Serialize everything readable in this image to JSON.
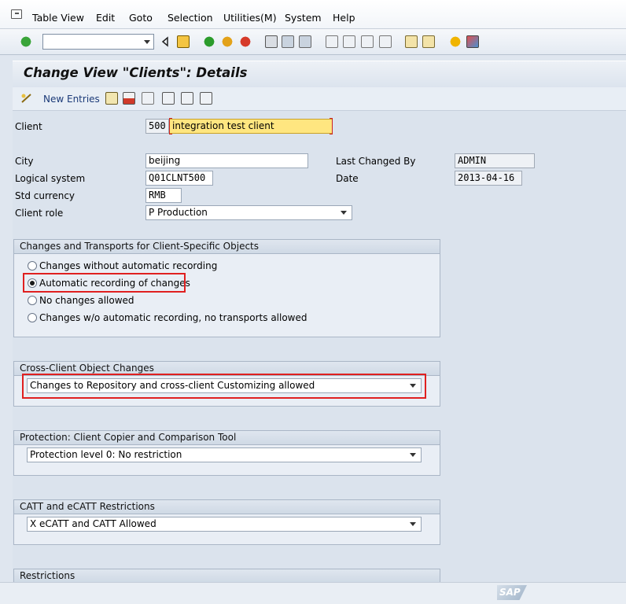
{
  "menu": {
    "items": [
      {
        "label": "Table View"
      },
      {
        "label": "Edit"
      },
      {
        "label": "Goto"
      },
      {
        "label": "Selection"
      },
      {
        "label": "Utilities(M)"
      },
      {
        "label": "System"
      },
      {
        "label": "Help"
      }
    ]
  },
  "toolbar": {
    "command_field_value": ""
  },
  "page": {
    "title": "Change View \"Clients\": Details"
  },
  "app_toolbar": {
    "new_entries_label": "New Entries"
  },
  "form": {
    "client_label": "Client",
    "client_value": "500",
    "client_name": "integration test client",
    "city_label": "City",
    "city_value": "beijing",
    "logical_system_label": "Logical system",
    "logical_system_value": "Q01CLNT500",
    "std_currency_label": "Std currency",
    "std_currency_value": "RMB",
    "client_role_label": "Client role",
    "client_role_value": "P Production",
    "last_changed_by_label": "Last Changed By",
    "last_changed_by_value": "ADMIN",
    "date_label": "Date",
    "date_value": "2013-04-16"
  },
  "groups": {
    "transports": {
      "title": "Changes and Transports for Client-Specific Objects",
      "options": [
        {
          "label": "Changes without automatic recording"
        },
        {
          "label": "Automatic recording of changes"
        },
        {
          "label": "No changes allowed"
        },
        {
          "label": "Changes w/o automatic recording, no transports allowed"
        }
      ],
      "selected_index": 1
    },
    "cross_client": {
      "title": "Cross-Client Object Changes",
      "value": "Changes to Repository and cross-client Customizing allowed"
    },
    "protection": {
      "title": "Protection: Client Copier and Comparison Tool",
      "value": "Protection level 0: No restriction"
    },
    "catt": {
      "title": "CATT and eCATT Restrictions",
      "value": "X eCATT and CATT Allowed"
    },
    "restrictions": {
      "title": "Restrictions"
    }
  },
  "status": {
    "logo_text": "SAP"
  },
  "colors": {
    "highlight_box": "#e02020",
    "title_bg": "#dce4ee",
    "client_name_bg": "#ffe680"
  }
}
